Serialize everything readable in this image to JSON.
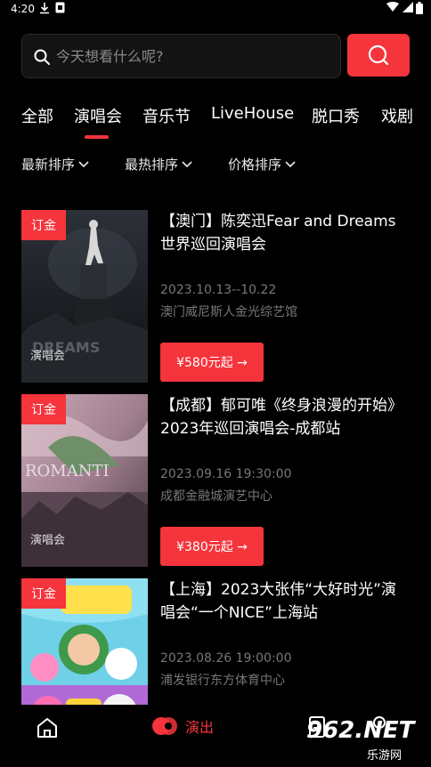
{
  "status_bar": {
    "time": "4:20"
  },
  "search": {
    "placeholder": "今天想看什么呢?"
  },
  "tabs": [
    {
      "label": "全部"
    },
    {
      "label": "演唱会"
    },
    {
      "label": "音乐节"
    },
    {
      "label": "LiveHouse"
    },
    {
      "label": "脱口秀"
    },
    {
      "label": "戏剧"
    }
  ],
  "active_tab": "演唱会",
  "sorts": [
    {
      "label": "最新排序"
    },
    {
      "label": "最热排序"
    },
    {
      "label": "价格排序"
    }
  ],
  "events": [
    {
      "badge": "订金",
      "poster_category": "演唱会",
      "title": "【澳门】陈奕迅Fear and Dreams世界巡回演唱会",
      "date": "2023.10.13--10.22",
      "venue": "澳门威尼斯人金光综艺馆",
      "price": "¥580元起 →"
    },
    {
      "badge": "订金",
      "poster_category": "演唱会",
      "title": "【成都】郁可唯《终身浪漫的开始》 2023年巡回演唱会-成都站",
      "date": "2023.09.16 19:30:00",
      "venue": "成都金融城演艺中心",
      "price": "¥380元起 →"
    },
    {
      "badge": "订金",
      "poster_category": "",
      "title": "【上海】2023大张伟“大好时光”演唱会“一个NICE”上海站",
      "date": "2023.08.26 19:00:00",
      "venue": "浦发银行东方体育中心",
      "price": ""
    }
  ],
  "bottom_nav": {
    "show_label": "演出"
  },
  "watermark": {
    "logo": "962.NET",
    "sub": "乐游网"
  },
  "colors": {
    "accent": "#f5343c",
    "background": "#000000",
    "muted_text": "#777777"
  },
  "icons": [
    "download-icon",
    "sim-icon",
    "wifi-icon",
    "battery-icon",
    "search-icon",
    "home-icon",
    "show-icon",
    "ticket-icon",
    "user-icon"
  ]
}
